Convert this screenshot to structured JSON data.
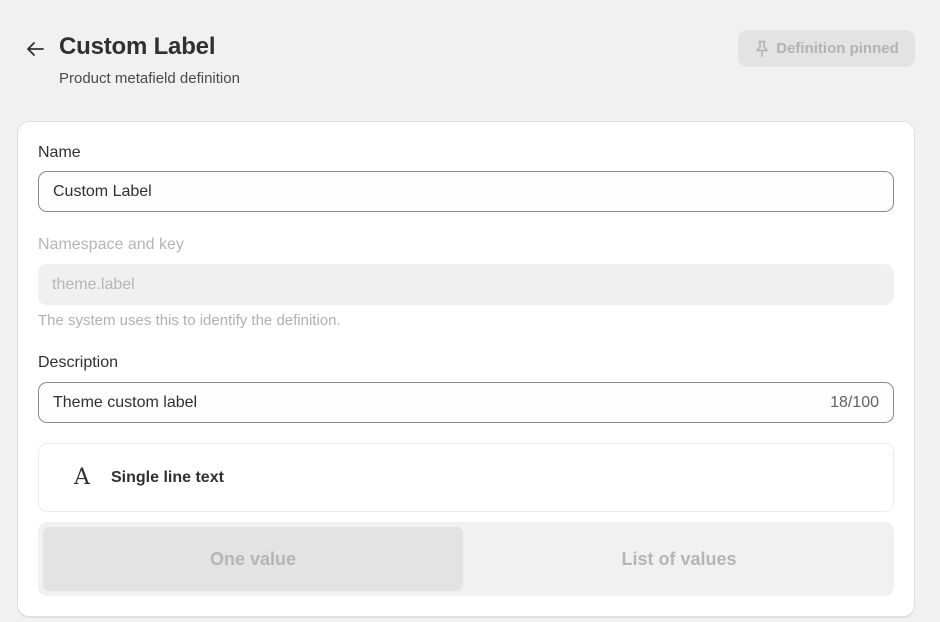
{
  "header": {
    "title": "Custom Label",
    "subtitle": "Product metafield definition",
    "back_icon": "arrow-left-icon",
    "pin_icon": "pin-icon",
    "pin_label": "Definition pinned"
  },
  "form": {
    "name_label": "Name",
    "name_value": "Custom Label",
    "namespace_label": "Namespace and key",
    "namespace_value": "theme.label",
    "namespace_help": "The system uses this to identify the definition.",
    "description_label": "Description",
    "description_value": "Theme custom label",
    "description_counter": "18/100",
    "type_icon": "A",
    "type_label": "Single line text",
    "value_options": [
      "One value",
      "List of values"
    ],
    "selected_option": "One value"
  },
  "colors": {
    "page_bg": "#f1f1f1",
    "card_bg": "#ffffff",
    "text": "#303030",
    "muted": "#b5b5b5"
  }
}
